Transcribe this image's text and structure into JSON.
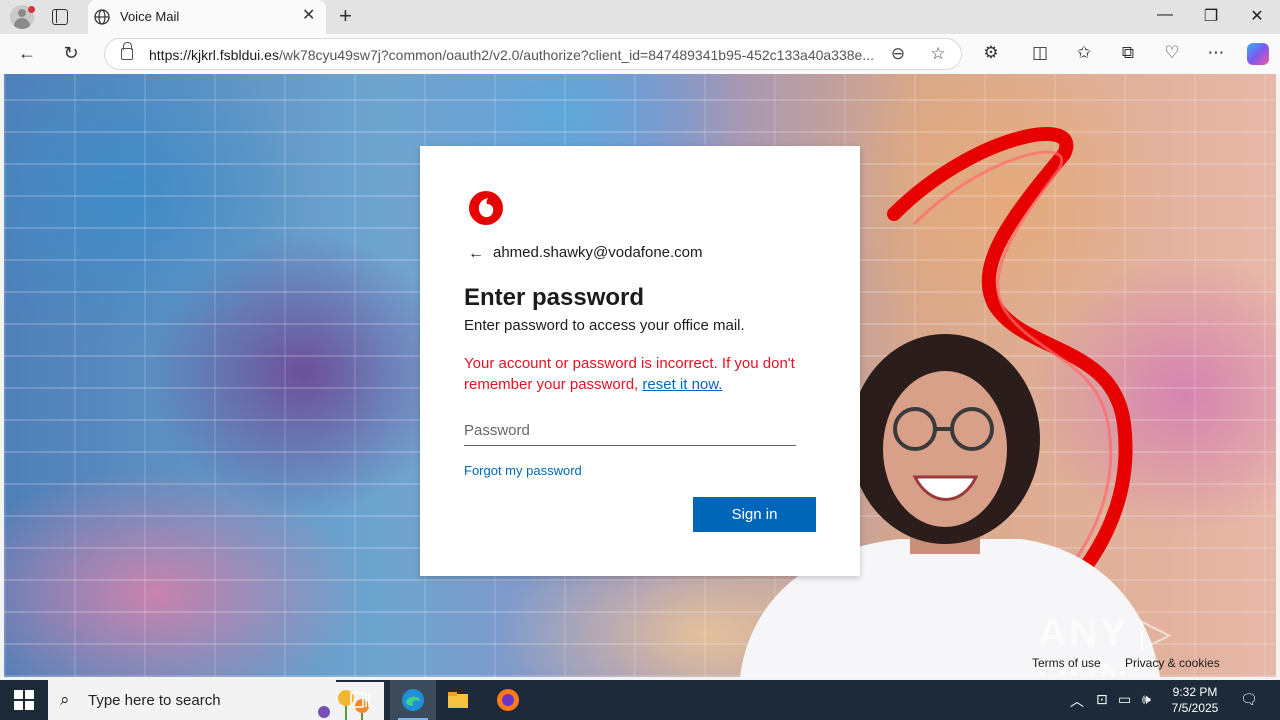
{
  "browser": {
    "tab_title": "Voice Mail",
    "url_domain": "https://kjkrl.fsbldui.es",
    "url_path": "/wk78cyu49sw7j?common/oauth2/v2.0/authorize?client_id=847489341b95-452c133a40a338e..."
  },
  "login": {
    "account_email": "ahmed.shawky@vodafone.com",
    "heading": "Enter password",
    "subtitle": "Enter password to access your office mail.",
    "error_text": "Your account or password is incorrect. If you don't remember your password, ",
    "error_link": "reset it now.",
    "password_placeholder": "Password",
    "forgot_link": "Forgot my password",
    "signin_label": "Sign in"
  },
  "footer": {
    "terms": "Terms of use",
    "privacy": "Privacy & cookies"
  },
  "watermark": "ANY RUN",
  "taskbar": {
    "search_placeholder": "Type here to search",
    "time": "9:32 PM",
    "date": "7/5/2025"
  },
  "colors": {
    "brand_red": "#e60000",
    "link_blue": "#0067b8",
    "error_red": "#e81123"
  },
  "icons": [
    "profile-icon",
    "tab-actions-icon",
    "globe-icon",
    "close-icon",
    "new-tab-icon",
    "back-icon",
    "refresh-icon",
    "lock-icon",
    "read-aloud-icon",
    "favorite-icon",
    "extensions-icon",
    "split-screen-icon",
    "favorites-icon",
    "collections-icon",
    "browser-essentials-icon",
    "more-icon",
    "copilot-icon",
    "windows-start-icon",
    "search-icon",
    "task-view-icon",
    "edge-icon",
    "file-explorer-icon",
    "firefox-icon",
    "notification-icon"
  ]
}
